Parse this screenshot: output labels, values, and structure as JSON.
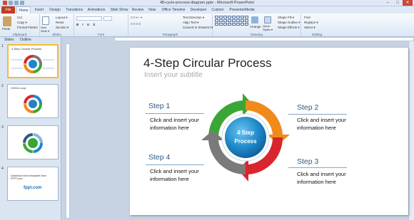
{
  "window": {
    "title": "48-cycle-process-diagram.pptx - Microsoft PowerPoint",
    "controls": [
      "–",
      "□",
      "✕"
    ]
  },
  "ribbon_tabs": [
    "File",
    "Home",
    "Insert",
    "Design",
    "Transitions",
    "Animations",
    "Slide Show",
    "Review",
    "View",
    "Office Timeline",
    "Developer",
    "Custom",
    "PresenterMedia"
  ],
  "ribbon": {
    "clipboard": {
      "label": "Clipboard",
      "paste": "Paste",
      "cut": "Cut",
      "copy": "Copy ▾",
      "format_painter": "Format Painter"
    },
    "slides": {
      "label": "Slides",
      "new_slide": "New Slide ▾",
      "layout": "Layout ▾",
      "reset": "Reset",
      "section": "Section ▾"
    },
    "font": {
      "label": "Font"
    },
    "paragraph": {
      "label": "Paragraph",
      "text_direction": "Text Direction ▾",
      "align_text": "Align Text ▾",
      "convert_smartart": "Convert to SmartArt ▾"
    },
    "drawing": {
      "label": "Drawing",
      "arrange": "Arrange",
      "quick_styles": "Quick Styles ▾",
      "shape_fill": "Shape Fill ▾",
      "shape_outline": "Shape Outline ▾",
      "shape_effects": "Shape Effects ▾"
    },
    "editing": {
      "label": "Editing",
      "find": "Find",
      "replace": "Replace ▾",
      "select": "Select ▾"
    }
  },
  "left_pane": {
    "tabs": [
      "Slides",
      "Outline"
    ],
    "thumbnails": [
      {
        "num": "1",
        "title": "4-Step Circular Process"
      },
      {
        "num": "2",
        "title": "OODA Loop"
      },
      {
        "num": "3",
        "title": ""
      },
      {
        "num": "4",
        "title": "Download more templates from FPPT.com",
        "logo": "fppt.com"
      }
    ]
  },
  "slide": {
    "title": "4-Step Circular Process",
    "subtitle": "Insert your subtitle",
    "center": [
      "4 Step",
      "Process"
    ],
    "steps": [
      {
        "label": "Step 1",
        "text": "Click and insert your information here"
      },
      {
        "label": "Step 2",
        "text": "Click and insert your information here"
      },
      {
        "label": "Step 3",
        "text": "Click and insert your information here"
      },
      {
        "label": "Step 4",
        "text": "Click and insert your information here"
      }
    ],
    "colors": {
      "green": "#3aa635",
      "orange": "#f08a1c",
      "red": "#d9262e",
      "gray": "#7a7a7a",
      "center": "#1e88c9",
      "step_text": "#2c5a82"
    }
  }
}
